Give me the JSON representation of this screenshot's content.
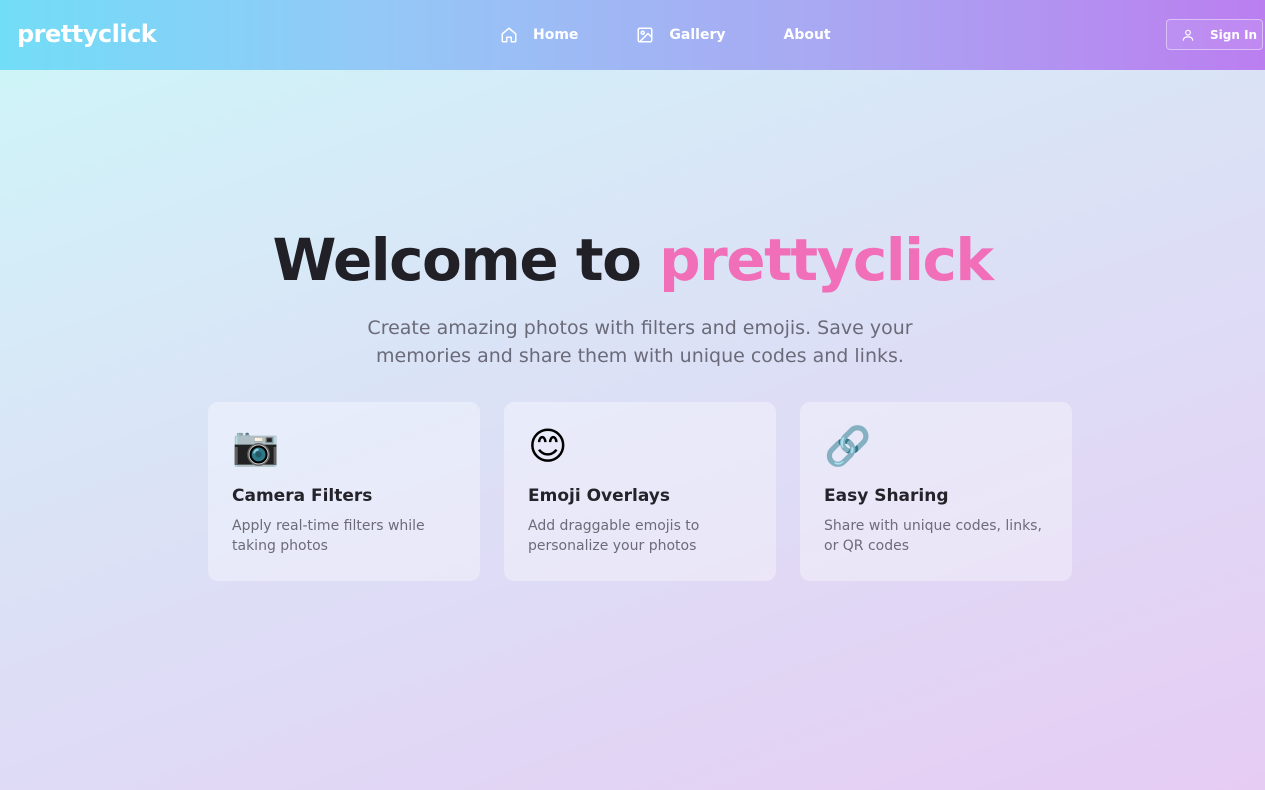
{
  "navbar": {
    "logo": "prettyclick",
    "links": [
      {
        "label": "Home",
        "icon": "home-icon"
      },
      {
        "label": "Gallery",
        "icon": "image-icon"
      },
      {
        "label": "About"
      }
    ],
    "signin_label": "Sign In",
    "signin_icon": "user-icon"
  },
  "hero": {
    "title_prefix": "Welcome to",
    "title_brand": "prettyclick",
    "brand_color": "#f06fb8",
    "subtitle": "Create amazing photos with filters and emojis. Save your memories and share them with unique codes and links."
  },
  "features": [
    {
      "emoji": "📷",
      "title": "Camera Filters",
      "description": "Apply real-time filters while taking photos"
    },
    {
      "emoji": "😊",
      "title": "Emoji Overlays",
      "description": "Add draggable emojis to personalize your photos"
    },
    {
      "emoji": "🔗",
      "title": "Easy Sharing",
      "description": "Share with unique codes, links, or QR codes"
    }
  ]
}
